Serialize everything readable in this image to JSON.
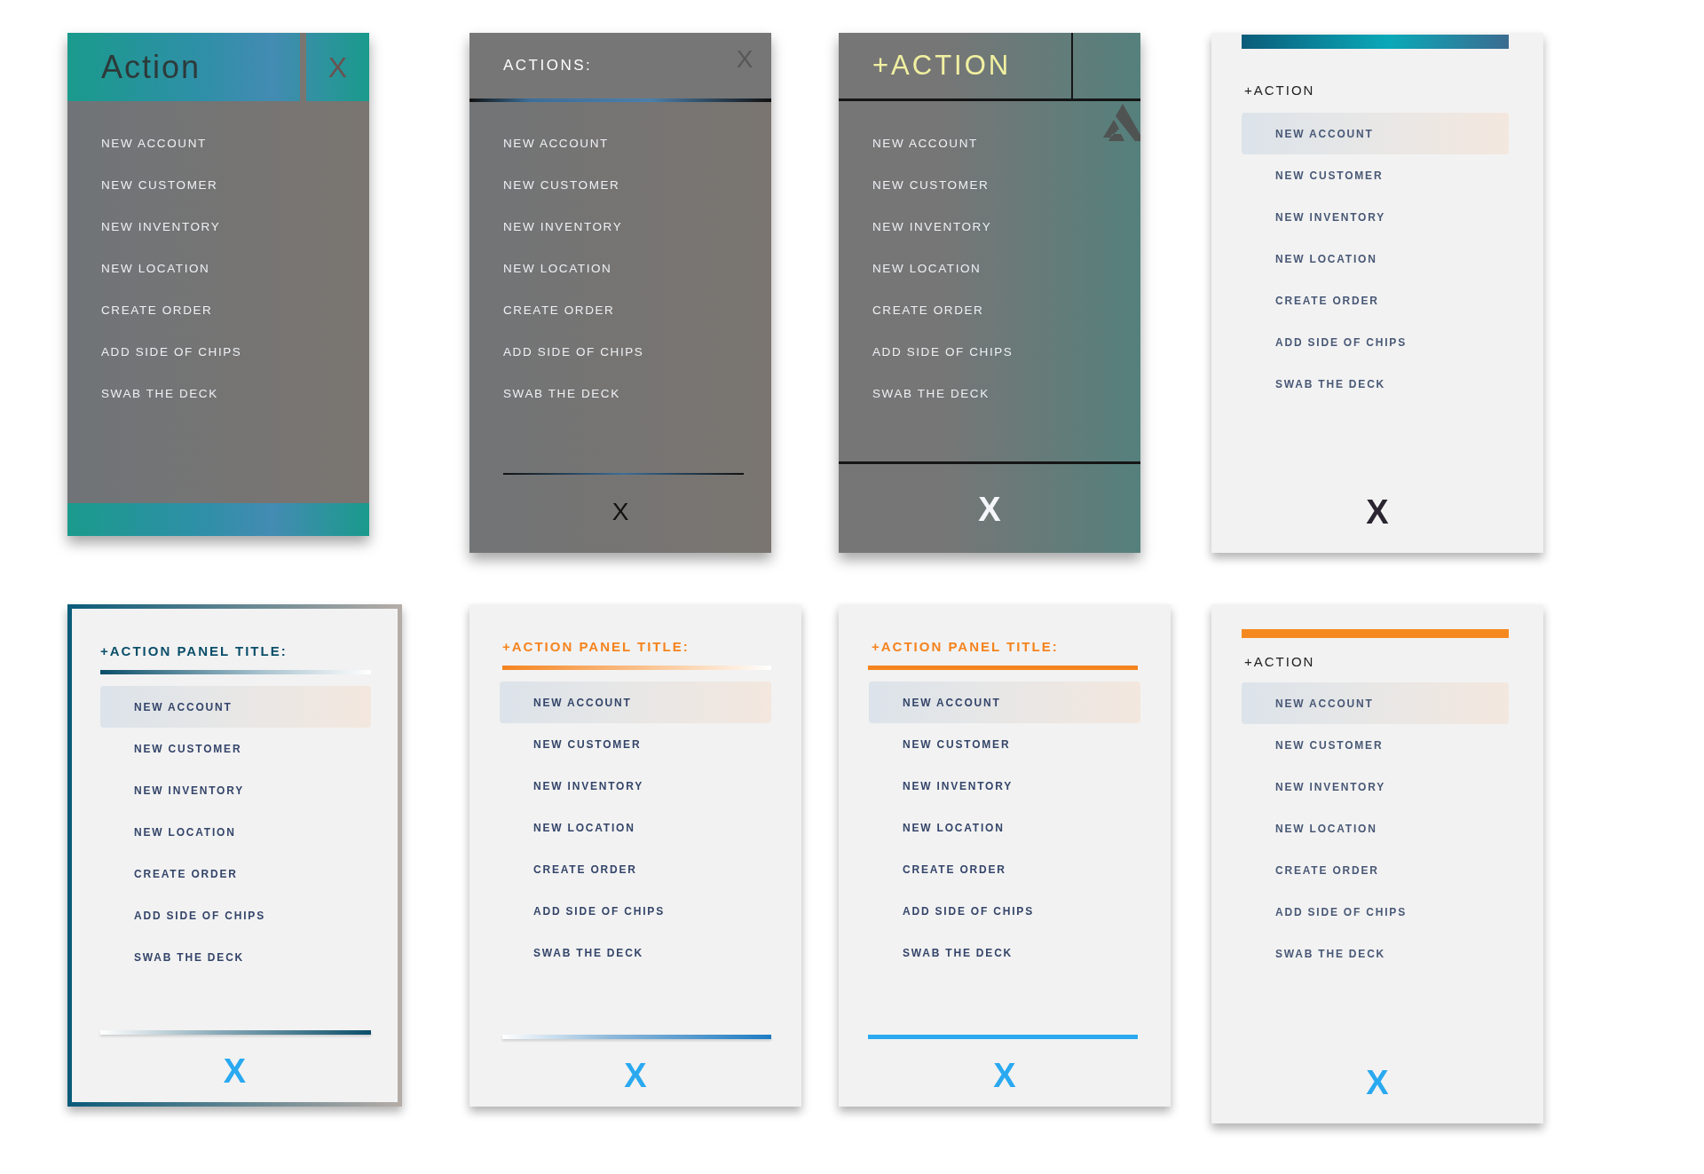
{
  "panels": [
    {
      "kind": "teal",
      "title": "Action",
      "header_close": "X",
      "items": [
        {
          "label": "NEW ACCOUNT"
        },
        {
          "label": "NEW CUSTOMER"
        },
        {
          "label": "NEW INVENTORY"
        },
        {
          "label": "NEW LOCATION"
        },
        {
          "label": "CREATE ORDER"
        },
        {
          "label": "ADD SIDE OF CHIPS"
        },
        {
          "label": "SWAB THE DECK"
        }
      ]
    },
    {
      "kind": "gray",
      "title": "ACTIONS:",
      "header_close": "X",
      "close": "X",
      "items": [
        {
          "label": "NEW ACCOUNT"
        },
        {
          "label": "NEW CUSTOMER"
        },
        {
          "label": "NEW INVENTORY"
        },
        {
          "label": "NEW LOCATION"
        },
        {
          "label": "CREATE ORDER"
        },
        {
          "label": "ADD SIDE OF CHIPS"
        },
        {
          "label": "SWAB THE DECK"
        }
      ]
    },
    {
      "kind": "gray-teal",
      "title": "+ACTION",
      "close": "X",
      "items": [
        {
          "label": "NEW ACCOUNT"
        },
        {
          "label": "NEW CUSTOMER"
        },
        {
          "label": "NEW INVENTORY"
        },
        {
          "label": "NEW LOCATION"
        },
        {
          "label": "CREATE ORDER"
        },
        {
          "label": "ADD SIDE OF CHIPS"
        },
        {
          "label": "SWAB THE DECK"
        }
      ]
    },
    {
      "kind": "light-bar",
      "title": "+ACTION",
      "close": "X",
      "items": [
        {
          "label": "NEW ACCOUNT",
          "selected": true
        },
        {
          "label": "NEW CUSTOMER",
          "selected": false
        },
        {
          "label": "NEW INVENTORY",
          "selected": false
        },
        {
          "label": "NEW LOCATION",
          "selected": false
        },
        {
          "label": "CREATE ORDER",
          "selected": false
        },
        {
          "label": "ADD SIDE OF CHIPS",
          "selected": false
        },
        {
          "label": "SWAB THE DECK",
          "selected": false
        }
      ]
    },
    {
      "kind": "framed",
      "title": "+ACTION PANEL TITLE:",
      "close": "X",
      "items": [
        {
          "label": "NEW ACCOUNT",
          "selected": true
        },
        {
          "label": "NEW CUSTOMER",
          "selected": false
        },
        {
          "label": "NEW INVENTORY",
          "selected": false
        },
        {
          "label": "NEW LOCATION",
          "selected": false
        },
        {
          "label": "CREATE ORDER",
          "selected": false
        },
        {
          "label": "ADD SIDE OF CHIPS",
          "selected": false
        },
        {
          "label": "SWAB THE DECK",
          "selected": false
        }
      ]
    },
    {
      "kind": "orange-fade",
      "title": "+ACTION PANEL TITLE:",
      "close": "X",
      "items": [
        {
          "label": "NEW ACCOUNT",
          "selected": true
        },
        {
          "label": "NEW CUSTOMER",
          "selected": false
        },
        {
          "label": "NEW INVENTORY",
          "selected": false
        },
        {
          "label": "NEW LOCATION",
          "selected": false
        },
        {
          "label": "CREATE ORDER",
          "selected": false
        },
        {
          "label": "ADD SIDE OF CHIPS",
          "selected": false
        },
        {
          "label": "SWAB THE DECK",
          "selected": false
        }
      ]
    },
    {
      "kind": "orange-solid",
      "title": "+ACTION PANEL TITLE:",
      "close": "X",
      "items": [
        {
          "label": "NEW ACCOUNT",
          "selected": true
        },
        {
          "label": "NEW CUSTOMER",
          "selected": false
        },
        {
          "label": "NEW INVENTORY",
          "selected": false
        },
        {
          "label": "NEW LOCATION",
          "selected": false
        },
        {
          "label": "CREATE ORDER",
          "selected": false
        },
        {
          "label": "ADD SIDE OF CHIPS",
          "selected": false
        },
        {
          "label": "SWAB THE DECK",
          "selected": false
        }
      ]
    },
    {
      "kind": "orange-bar",
      "title": "+ACTION",
      "close": "X",
      "items": [
        {
          "label": "NEW ACCOUNT",
          "selected": true
        },
        {
          "label": "NEW CUSTOMER",
          "selected": false
        },
        {
          "label": "NEW INVENTORY",
          "selected": false
        },
        {
          "label": "NEW LOCATION",
          "selected": false
        },
        {
          "label": "CREATE ORDER",
          "selected": false
        },
        {
          "label": "ADD SIDE OF CHIPS",
          "selected": false
        },
        {
          "label": "SWAB THE DECK",
          "selected": false
        }
      ]
    }
  ]
}
